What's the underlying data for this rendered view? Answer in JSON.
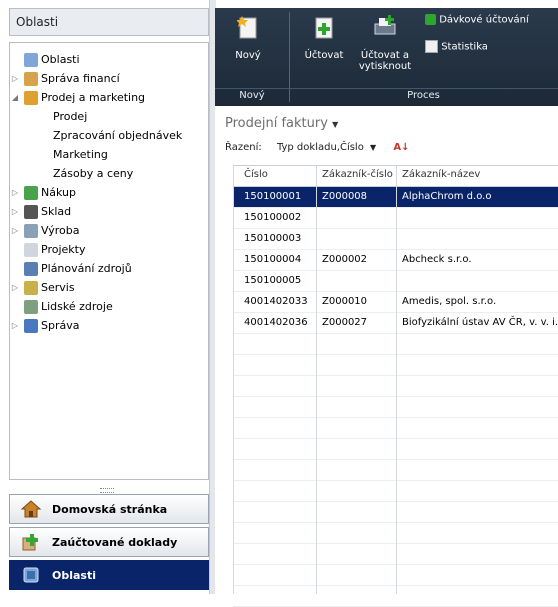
{
  "left_panel": {
    "title": "Oblasti",
    "tree": [
      {
        "label": "Oblasti",
        "level": 0,
        "expander": "",
        "icon": "areas-icon"
      },
      {
        "label": "Správa financí",
        "level": 0,
        "expander": "▷",
        "icon": "finance-icon"
      },
      {
        "label": "Prodej a marketing",
        "level": 0,
        "expander": "◢",
        "icon": "sales-marketing-icon"
      },
      {
        "label": "Prodej",
        "level": 1
      },
      {
        "label": "Zpracování objednávek",
        "level": 1
      },
      {
        "label": "Marketing",
        "level": 1
      },
      {
        "label": "Zásoby a ceny",
        "level": 1
      },
      {
        "label": "Nákup",
        "level": 0,
        "expander": "▷",
        "icon": "purchase-icon"
      },
      {
        "label": "Sklad",
        "level": 0,
        "expander": "▷",
        "icon": "warehouse-icon"
      },
      {
        "label": "Výroba",
        "level": 0,
        "expander": "▷",
        "icon": "manufacturing-icon"
      },
      {
        "label": "Projekty",
        "level": 0,
        "expander": "",
        "icon": "projects-icon"
      },
      {
        "label": "Plánování zdrojů",
        "level": 0,
        "expander": "",
        "icon": "resource-planning-icon"
      },
      {
        "label": "Servis",
        "level": 0,
        "expander": "▷",
        "icon": "service-icon"
      },
      {
        "label": "Lidské zdroje",
        "level": 0,
        "expander": "",
        "icon": "human-resources-icon"
      },
      {
        "label": "Správa",
        "level": 0,
        "expander": "▷",
        "icon": "administration-icon"
      }
    ],
    "nav_buttons": [
      {
        "label": "Domovská stránka",
        "icon": "home-icon"
      },
      {
        "label": "Zaúčtované doklady",
        "icon": "posted-documents-icon"
      },
      {
        "label": "Oblasti",
        "icon": "areas-icon"
      }
    ]
  },
  "ribbon": {
    "groups": [
      {
        "label": "Nový"
      },
      {
        "label": "Proces"
      }
    ],
    "buttons": {
      "new": "Nový",
      "post": "Účtovat",
      "post_print_line1": "Účtovat a",
      "post_print_line2": "vytisknout",
      "batch_posting": "Dávkové účtování",
      "statistics": "Statistika"
    }
  },
  "list": {
    "title": "Prodejní faktury",
    "sort_label": "Řazení:",
    "sort_value": "Typ dokladu,Číslo",
    "columns": [
      "Číslo",
      "Zákazník-číslo",
      "Zákazník-název"
    ],
    "rows": [
      {
        "cislo": "150100001",
        "zakaznik_cislo": "Z000008",
        "zakaznik_nazev": "AlphaChrom d.o.o",
        "selected": true
      },
      {
        "cislo": "150100002",
        "zakaznik_cislo": "",
        "zakaznik_nazev": ""
      },
      {
        "cislo": "150100003",
        "zakaznik_cislo": "",
        "zakaznik_nazev": ""
      },
      {
        "cislo": "150100004",
        "zakaznik_cislo": "Z000002",
        "zakaznik_nazev": "Abcheck s.r.o."
      },
      {
        "cislo": "150100005",
        "zakaznik_cislo": "",
        "zakaznik_nazev": ""
      },
      {
        "cislo": "4001402033",
        "zakaznik_cislo": "Z000010",
        "zakaznik_nazev": "Amedis, spol. s.r.o."
      },
      {
        "cislo": "4001402036",
        "zakaznik_cislo": "Z000027",
        "zakaznik_nazev": "Biofyzikální ústav AV ČR, v. v. i."
      }
    ]
  },
  "colors": {
    "selection": "#0a246a",
    "ribbon_bg": "#1d2937",
    "title_text": "#6d6d6d"
  }
}
